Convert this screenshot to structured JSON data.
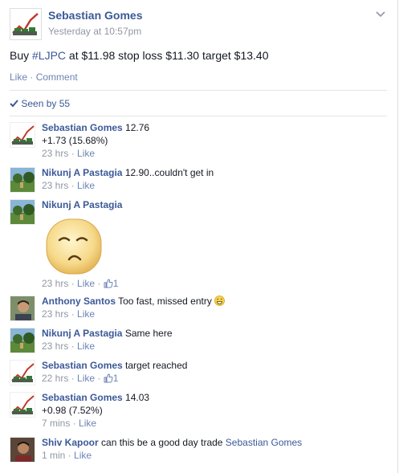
{
  "post": {
    "author": "Sebastian Gomes",
    "time": "Yesterday at 10:57pm",
    "text_prefix": "Buy ",
    "hashtag": "#LJPC",
    "text_suffix": " at $11.98 stop loss $11.30 target $13.40",
    "like": "Like",
    "comment": "Comment",
    "seen_by": "Seen by 55"
  },
  "comments": [
    {
      "name": "Sebastian Gomes",
      "text": " 12.76",
      "line2": "+1.73 (15.68%)",
      "time": "23 hrs",
      "like": "Like",
      "likes": ""
    },
    {
      "name": "Nikunj A Pastagia",
      "text": " 12.90..couldn't get in",
      "line2": "",
      "time": "23 hrs",
      "like": "Like",
      "likes": ""
    },
    {
      "name": "Nikunj A Pastagia",
      "text": "",
      "line2": "",
      "time": "23 hrs",
      "like": "Like",
      "likes": "1"
    },
    {
      "name": "Anthony Santos",
      "text": " Too fast, missed entry",
      "line2": "",
      "time": "23 hrs",
      "like": "Like",
      "likes": ""
    },
    {
      "name": "Nikunj A Pastagia",
      "text": " Same here",
      "line2": "",
      "time": "23 hrs",
      "like": "Like",
      "likes": ""
    },
    {
      "name": "Sebastian Gomes",
      "text": " target reached",
      "line2": "",
      "time": "22 hrs",
      "like": "Like",
      "likes": "1"
    },
    {
      "name": "Sebastian Gomes",
      "text": " 14.03",
      "line2": "+0.98 (7.52%)",
      "time": "7 mins",
      "like": "Like",
      "likes": ""
    },
    {
      "name": "Shiv Kapoor",
      "text": " can this be a good day trade ",
      "mention": "Sebastian Gomes",
      "line2": "",
      "time": "1 min",
      "like": "Like",
      "likes": ""
    }
  ],
  "colors": {
    "link": "#3b5998",
    "meta": "#9197a3",
    "action": "#6d84b4"
  }
}
